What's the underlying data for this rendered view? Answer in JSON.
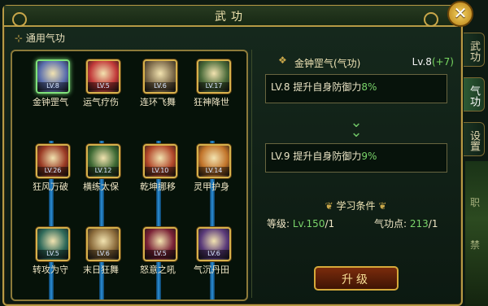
{
  "window": {
    "title": "武功"
  },
  "tabs": [
    {
      "label": "武功",
      "active": false
    },
    {
      "label": "气功",
      "active": true
    },
    {
      "label": "设置",
      "active": false
    }
  ],
  "side_decor_text": [
    "职",
    "禁"
  ],
  "section": {
    "label": "通用气功"
  },
  "skills": [
    {
      "name": "金钟罡气",
      "level": "LV.8",
      "color": "#5b6fae",
      "selected": true
    },
    {
      "name": "运气疗伤",
      "level": "LV.5",
      "color": "#c23a3a",
      "selected": false
    },
    {
      "name": "连环飞舞",
      "level": "LV.6",
      "color": "#7d6a4a",
      "selected": false
    },
    {
      "name": "狂神降世",
      "level": "LV.17",
      "color": "#4b6b3a",
      "selected": false
    },
    {
      "name": "狂风万破",
      "level": "LV.26",
      "color": "#9a3a24",
      "selected": false
    },
    {
      "name": "横练太保",
      "level": "LV.12",
      "color": "#3e6a34",
      "selected": false
    },
    {
      "name": "乾坤挪移",
      "level": "LV.10",
      "color": "#b2472a",
      "selected": false
    },
    {
      "name": "灵甲护身",
      "level": "LV.14",
      "color": "#c2742a",
      "selected": false
    },
    {
      "name": "转攻为守",
      "level": "LV.5",
      "color": "#2f6a5a",
      "selected": false
    },
    {
      "name": "末日狂舞",
      "level": "LV.6",
      "color": "#8a6a3a",
      "selected": false
    },
    {
      "name": "怒意之吼",
      "level": "LV.5",
      "color": "#7a2236",
      "selected": false
    },
    {
      "name": "气沉丹田",
      "level": "LV.6",
      "color": "#5a3a7a",
      "selected": false
    }
  ],
  "detail": {
    "name": "金钟罡气(气功)",
    "level": "Lv.8",
    "bonus": "(+7)",
    "current": {
      "level": "LV.8",
      "text": "提升自身防御力",
      "value": "8%"
    },
    "next": {
      "level": "LV.9",
      "text": "提升自身防御力",
      "value": "9%"
    }
  },
  "conditions": {
    "title": "学习条件",
    "grade": {
      "label": "等级:",
      "value": "Lv.150",
      "suffix": "/1"
    },
    "points": {
      "label": "气功点:",
      "value": "213",
      "suffix": "/1"
    }
  },
  "upgrade_button": "升级"
}
